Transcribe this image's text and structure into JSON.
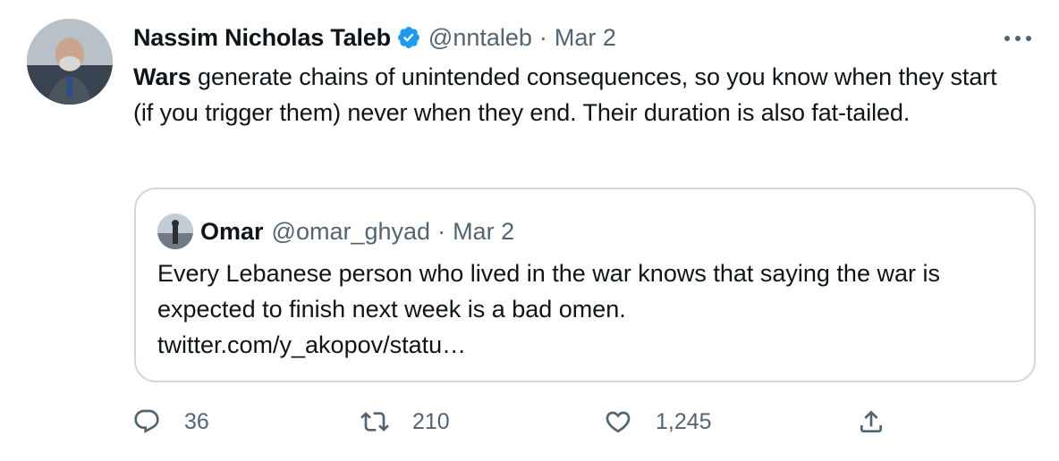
{
  "tweet": {
    "author_name": "Nassim Nicholas Taleb",
    "handle": "@nntaleb",
    "separator": "·",
    "date": "Mar 2",
    "verified": true,
    "text_bold": "Wars",
    "text_rest": " generate chains of unintended consequences, so you know when they start (if you trigger them) never when they end. Their duration is also fat-tailed.",
    "more_icon": "more-horizontal-icon"
  },
  "quote": {
    "author_name": "Omar",
    "handle": "@omar_ghyad",
    "separator": "·",
    "date": "Mar 2",
    "text": "Every Lebanese person who lived in the war knows that saying the war is expected to finish next week is a bad omen.",
    "link": "twitter.com/y_akopov/statu…"
  },
  "actions": {
    "replies": "36",
    "retweets": "210",
    "likes": "1,245"
  },
  "colors": {
    "text": "#0f1419",
    "secondary": "#536471",
    "border": "#cfd9de",
    "verified": "#1d9bf0"
  }
}
